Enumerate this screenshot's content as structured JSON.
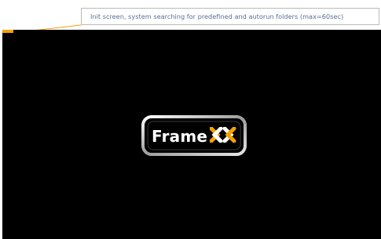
{
  "annotation": {
    "text": "Init screen, system searching for predefined and autorun folders (max=60sec)"
  },
  "splash": {
    "logo_word": "Frame",
    "logo_mark": "XX",
    "progress": 0.03
  },
  "colors": {
    "screen_background": "#000000",
    "progress": "#f4a200",
    "annotation_text": "#5a6f98",
    "logo_accent": "#f4a200",
    "logo_frame": "#d9d9d9"
  },
  "icons": {
    "logo_mark": "frame-xx-logo-icon"
  }
}
